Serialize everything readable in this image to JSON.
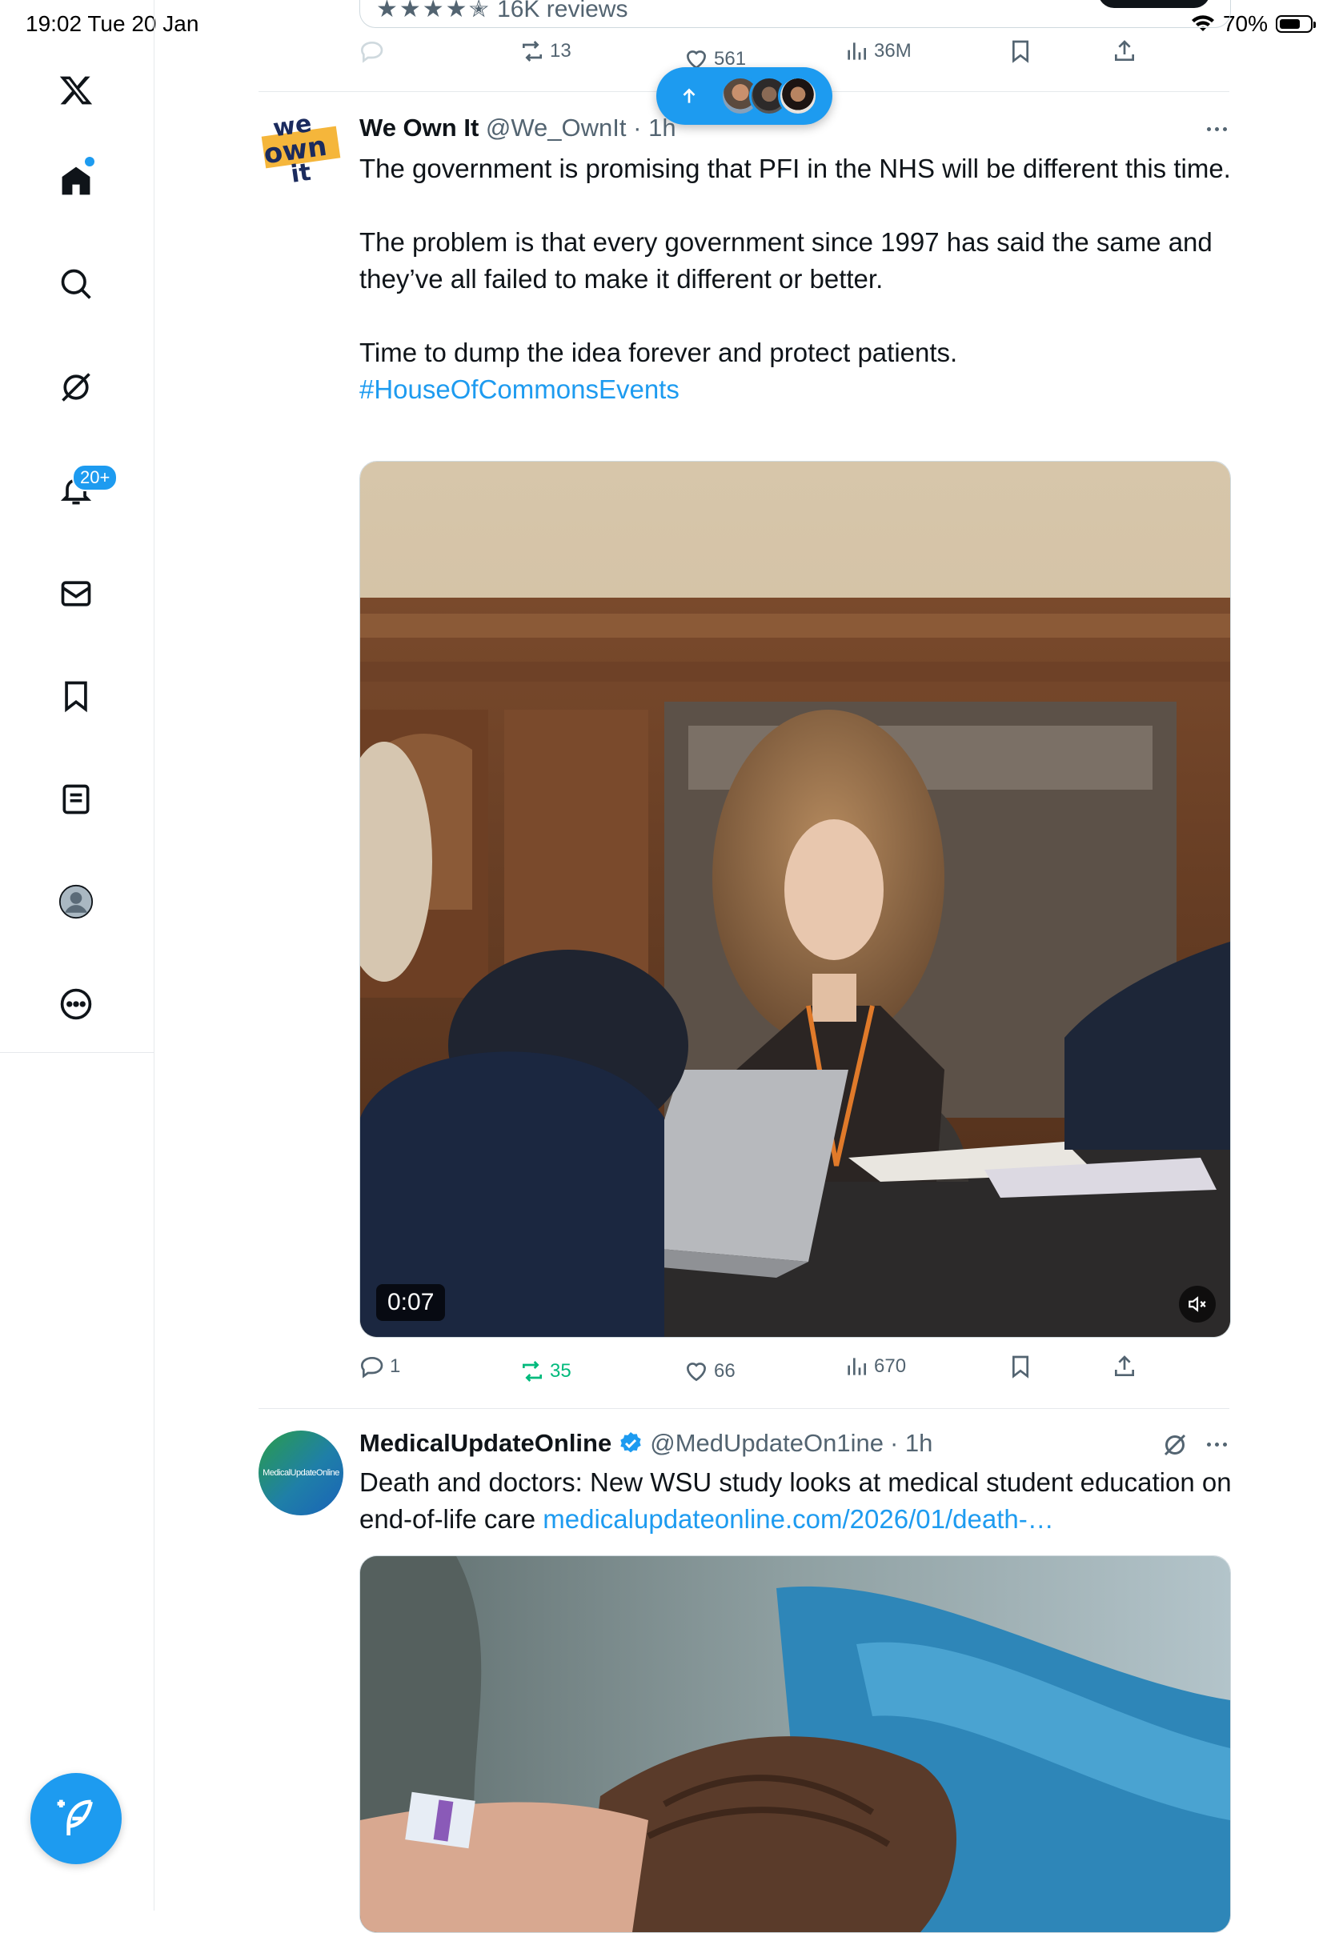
{
  "status_bar": {
    "time_date": "19:02   Tue 20 Jan",
    "battery_percent": "70%",
    "battery_level": 0.7
  },
  "sidebar": {
    "items": [
      {
        "name": "x-logo-icon"
      },
      {
        "name": "home-icon",
        "active": true
      },
      {
        "name": "search-icon"
      },
      {
        "name": "grok-icon"
      },
      {
        "name": "notifications-icon",
        "badge": "20+"
      },
      {
        "name": "messages-icon"
      },
      {
        "name": "bookmarks-icon"
      },
      {
        "name": "lists-icon"
      },
      {
        "name": "profile-icon"
      },
      {
        "name": "more-icon"
      }
    ],
    "compose_icon": "compose-feather-icon"
  },
  "feed": {
    "ad_remnant": {
      "rating_stars": 4.5,
      "reviews": "16K reviews"
    },
    "previous_post_actions": {
      "replies": "",
      "reposts": "13",
      "likes": "561",
      "views": "36M"
    },
    "new_posts_pill": {
      "icon": "arrow-up-icon",
      "avatar_count": 3
    },
    "tweets": [
      {
        "display_name": "We Own It",
        "handle": "@We_OwnIt",
        "time": "· 1h",
        "avatar_text": "we own it",
        "paragraphs": [
          "The government is promising that PFI in the NHS will be different this time.",
          "The problem is that every government since 1997 has said the same and they’ve all failed to make it different or better.",
          "Time to dump the idea forever and protect patients."
        ],
        "hashtag": "#HouseOfCommonsEvents",
        "video": {
          "duration": "0:07",
          "muted": true
        },
        "actions": {
          "replies": "1",
          "reposts": "35",
          "likes": "66",
          "views": "670"
        },
        "colors": {
          "repost_active": "#00ba7c"
        }
      },
      {
        "display_name": "MedicalUpdateOnline",
        "verified": true,
        "handle": "@MedUpdateOn1ine",
        "time": "· 1h",
        "avatar_text": "MedicalUpdateOnline",
        "text": "Death and doctors: New WSU study looks at medical student education on end-of-life care ",
        "link": "medicalupdateonline.com/2026/01/death-…"
      }
    ]
  },
  "colors": {
    "accent": "#1d9bf0",
    "text_primary": "#0f1419",
    "text_secondary": "#536471",
    "divider": "#e6e9ec"
  }
}
